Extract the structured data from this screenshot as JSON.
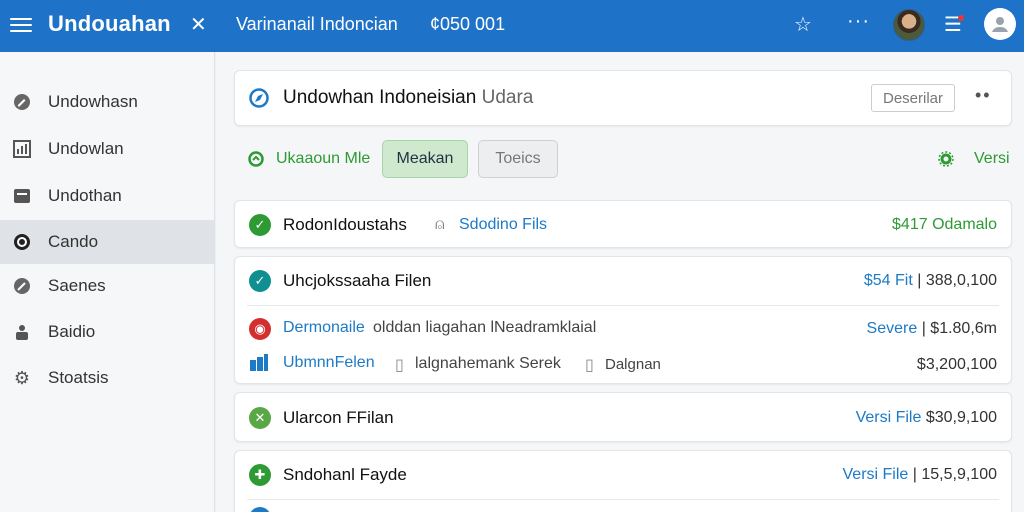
{
  "topbar": {
    "app_title": "Undouahan",
    "window_title": "Varinanail  Indoncian",
    "window_code": "¢050 001"
  },
  "sidebar": {
    "items": [
      {
        "label": "Undowhasn",
        "icon": "edit-icon"
      },
      {
        "label": "Undowlan",
        "icon": "chart-icon"
      },
      {
        "label": "Undothan",
        "icon": "folder-icon"
      },
      {
        "label": "Cando",
        "icon": "block-icon",
        "active": true
      },
      {
        "label": "Saenes",
        "icon": "pen-icon"
      },
      {
        "label": "Baidio",
        "icon": "people-icon"
      },
      {
        "label": "Stoatsis",
        "icon": "gear-icon"
      }
    ]
  },
  "header": {
    "title": "Undowhan Indoneisian",
    "title_muted": "Udara",
    "desc_button": "Deserilar",
    "more": "••"
  },
  "toolbar": {
    "upload_label": "Ukaaoun Mle",
    "tab_active": "Meakan",
    "tab_inactive": "Toeics",
    "versi_label": "Versi"
  },
  "rows": {
    "r1": {
      "title": "RodonIdoustahs",
      "link": "Sdodino Fils",
      "right": "$417  Odamalo"
    },
    "r2": {
      "title": "Uhcjokssaaha Filen",
      "right_link": "$54 Fit",
      "right_value": "| 388,0,100"
    },
    "r2b": {
      "title": "Dermonaile",
      "desc": "olddan liagahan lNeadramklaial",
      "right_link": "Severe",
      "right_value": "| $1.80,6m"
    },
    "r2c": {
      "title": "UbmnnFelen",
      "mid": "lalgnahemank Serek",
      "mid2": "Dalgnan",
      "right_value": "$3,200,100"
    },
    "r3": {
      "title": "Ularcon FFilan",
      "right_link": "Versi File",
      "right_value": "$30,9,100"
    },
    "r4": {
      "title": "Sndohanl Fayde",
      "right_link": "Versi File",
      "right_value": "| 15,5,9,100"
    }
  },
  "colors": {
    "topbar": "#1e73c8",
    "accent_green": "#2e9a34",
    "accent_blue": "#1c7ac6",
    "danger": "#d32f2f"
  }
}
